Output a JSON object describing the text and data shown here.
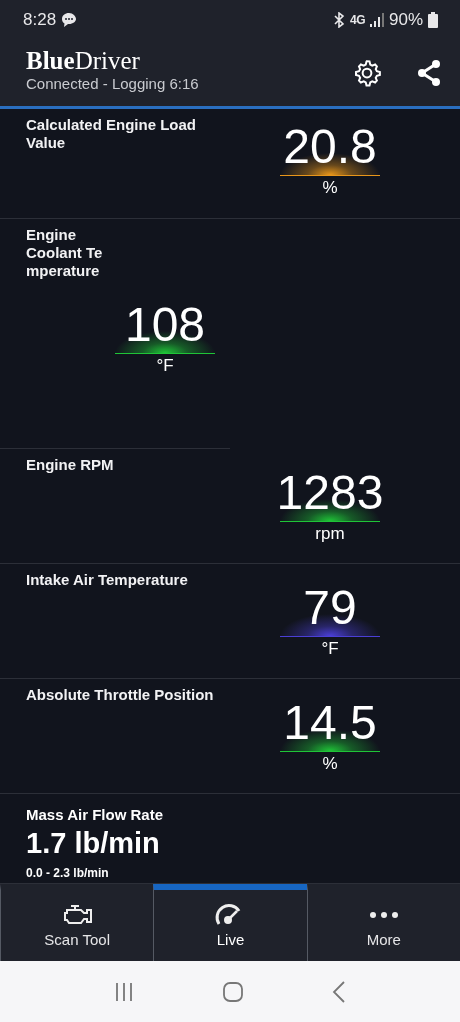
{
  "status_bar": {
    "time": "8:28",
    "network": "4G",
    "battery": "90%"
  },
  "header": {
    "brand_bold": "Blue",
    "brand_rest": "Driver",
    "subtitle": "Connected - Logging 6:16"
  },
  "gauges": [
    {
      "kind": "wide",
      "label": "Calculated Engine Load Value",
      "value": "20.8",
      "unit": "%",
      "color": "#e8961a"
    },
    {
      "kind": "half",
      "label": "Engine Coolant Te mperature",
      "value": "108",
      "unit": "°F",
      "color": "#1fc437"
    },
    {
      "kind": "wide",
      "label": "Engine RPM",
      "value": "1283",
      "unit": "rpm",
      "color": "#1fc437"
    },
    {
      "kind": "wide",
      "label": "Intake Air Temperature",
      "value": "79",
      "unit": "°F",
      "color": "#4b3fd6"
    },
    {
      "kind": "wide",
      "label": "Absolute Throttle Position",
      "value": "14.5",
      "unit": "%",
      "color": "#1fc437"
    },
    {
      "kind": "text",
      "label": "Mass Air Flow Rate",
      "value": "1.7",
      "unit": "lb/min",
      "range": "0.0 - 2.3 lb/min"
    }
  ],
  "tabs": [
    {
      "label": "Scan Tool",
      "selected": false
    },
    {
      "label": "Live",
      "selected": true
    },
    {
      "label": "More",
      "selected": false
    }
  ]
}
